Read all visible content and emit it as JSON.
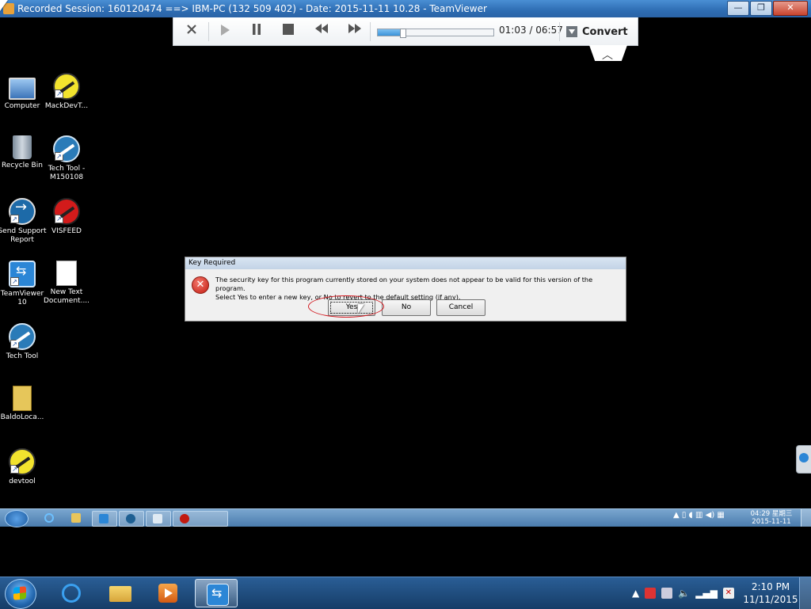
{
  "window": {
    "title": "Recorded Session: 160120474 ==> IBM-PC (132 509 402) - Date: 2015-11-11 10.28 - TeamViewer",
    "buttons": {
      "minimize": "—",
      "maximize": "❐",
      "close": "✕"
    }
  },
  "player": {
    "time": "01:03 / 06:57",
    "progress": 0.21,
    "convert_label": "Convert",
    "icons": [
      "close-icon",
      "play-icon",
      "pause-icon",
      "stop-icon",
      "rewind-icon",
      "fast-forward-icon"
    ]
  },
  "desktop": {
    "icons": [
      {
        "label": "Computer",
        "icon": "computer-icon"
      },
      {
        "label": "MackDevT...",
        "icon": "wrench-app-icon"
      },
      {
        "label": "Recycle Bin",
        "icon": "recycle-bin-icon"
      },
      {
        "label": "Tech Tool - M150108",
        "icon": "tech-tool-icon"
      },
      {
        "label": "Send Support Report",
        "icon": "support-report-icon"
      },
      {
        "label": "VISFEED",
        "icon": "visfeed-icon"
      },
      {
        "label": "TeamViewer 10",
        "icon": "teamviewer-icon"
      },
      {
        "label": "New Text Document....",
        "icon": "text-document-icon"
      },
      {
        "label": "Tech Tool",
        "icon": "tech-tool-icon"
      },
      {
        "label": "BaldoLoca...",
        "icon": "zip-icon"
      },
      {
        "label": "devtool",
        "icon": "wrench-app-icon"
      }
    ]
  },
  "dialog": {
    "title": "Key Required",
    "message_line1": "The security key for this program currently stored on your system does not appear to be valid for this version of the program.",
    "message_line2": "Select Yes to enter a new key, or No to revert to the default setting (if any).",
    "buttons": {
      "yes": "Yes",
      "no": "No",
      "cancel": "Cancel"
    }
  },
  "remote_taskbar": {
    "clock_time": "04:29 星期三",
    "clock_date": "2015-11-11"
  },
  "local_taskbar": {
    "clock_time": "2:10 PM",
    "clock_date": "11/11/2015"
  },
  "colors": {
    "accent": "#2b86d6",
    "dialog_error": "#c21a10",
    "annotation_ring": "#d2181f"
  }
}
